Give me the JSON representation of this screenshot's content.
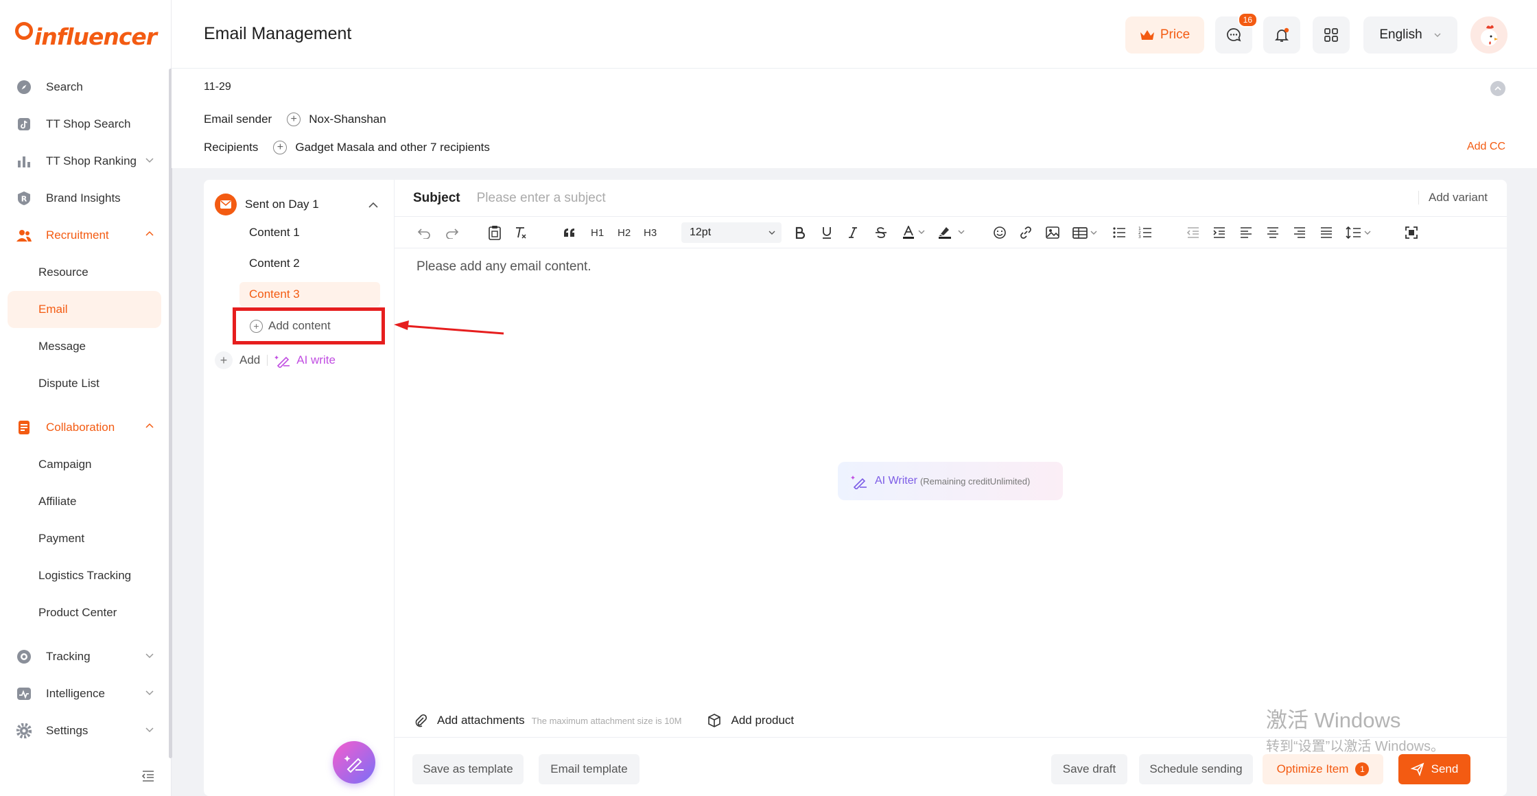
{
  "brand": {
    "name": "influencer"
  },
  "sidebar": {
    "items": [
      {
        "label": "Search",
        "icon": "compass-icon"
      },
      {
        "label": "TT Shop Search",
        "icon": "tiktok-icon"
      },
      {
        "label": "TT Shop Ranking",
        "icon": "bar-chart-icon"
      },
      {
        "label": "Brand Insights",
        "icon": "r-badge-icon"
      },
      {
        "label": "Recruitment",
        "icon": "users-icon"
      },
      {
        "label": "Resource"
      },
      {
        "label": "Email"
      },
      {
        "label": "Message"
      },
      {
        "label": "Dispute List"
      },
      {
        "label": "Collaboration",
        "icon": "document-icon"
      },
      {
        "label": "Campaign"
      },
      {
        "label": "Affiliate"
      },
      {
        "label": "Payment"
      },
      {
        "label": "Logistics Tracking"
      },
      {
        "label": "Product Center"
      },
      {
        "label": "Tracking",
        "icon": "target-icon"
      },
      {
        "label": "Intelligence",
        "icon": "pulse-icon"
      },
      {
        "label": "Settings",
        "icon": "gear-icon"
      }
    ]
  },
  "header": {
    "title": "Email Management",
    "price_label": "Price",
    "message_count": "16",
    "language": "English"
  },
  "email": {
    "date": "11-29",
    "sender_label": "Email sender",
    "sender_value": "Nox-Shanshan",
    "recipients_label": "Recipients",
    "recipients_value": "Gadget Masala and other 7 recipients",
    "add_cc": "Add CC"
  },
  "sequence": {
    "step_label": "Sent on Day 1",
    "contents": [
      "Content 1",
      "Content 2",
      "Content 3"
    ],
    "add_content": "Add content",
    "add": "Add",
    "ai_write": "AI write"
  },
  "editor": {
    "subject_label": "Subject",
    "subject_placeholder": "Please enter a subject",
    "add_variant": "Add variant",
    "font_size": "12pt",
    "h1": "H1",
    "h2": "H2",
    "h3": "H3",
    "body_placeholder": "Please add any email content.",
    "ai_writer_title": "AI Writer",
    "ai_writer_sub": "(Remaining creditUnlimited)",
    "add_attachments": "Add attachments",
    "attach_hint": "The maximum attachment size is 10M",
    "add_product": "Add product"
  },
  "footer": {
    "save_template": "Save as template",
    "email_template": "Email template",
    "save_draft": "Save draft",
    "schedule": "Schedule sending",
    "optimize": "Optimize Item",
    "optimize_count": "1",
    "send": "Send"
  },
  "watermark": {
    "line1": "激活 Windows",
    "line2": "转到“设置”以激活 Windows。"
  },
  "colors": {
    "accent": "#f35b12",
    "highlight": "#e61e1e",
    "ai": "#c14ee2"
  }
}
